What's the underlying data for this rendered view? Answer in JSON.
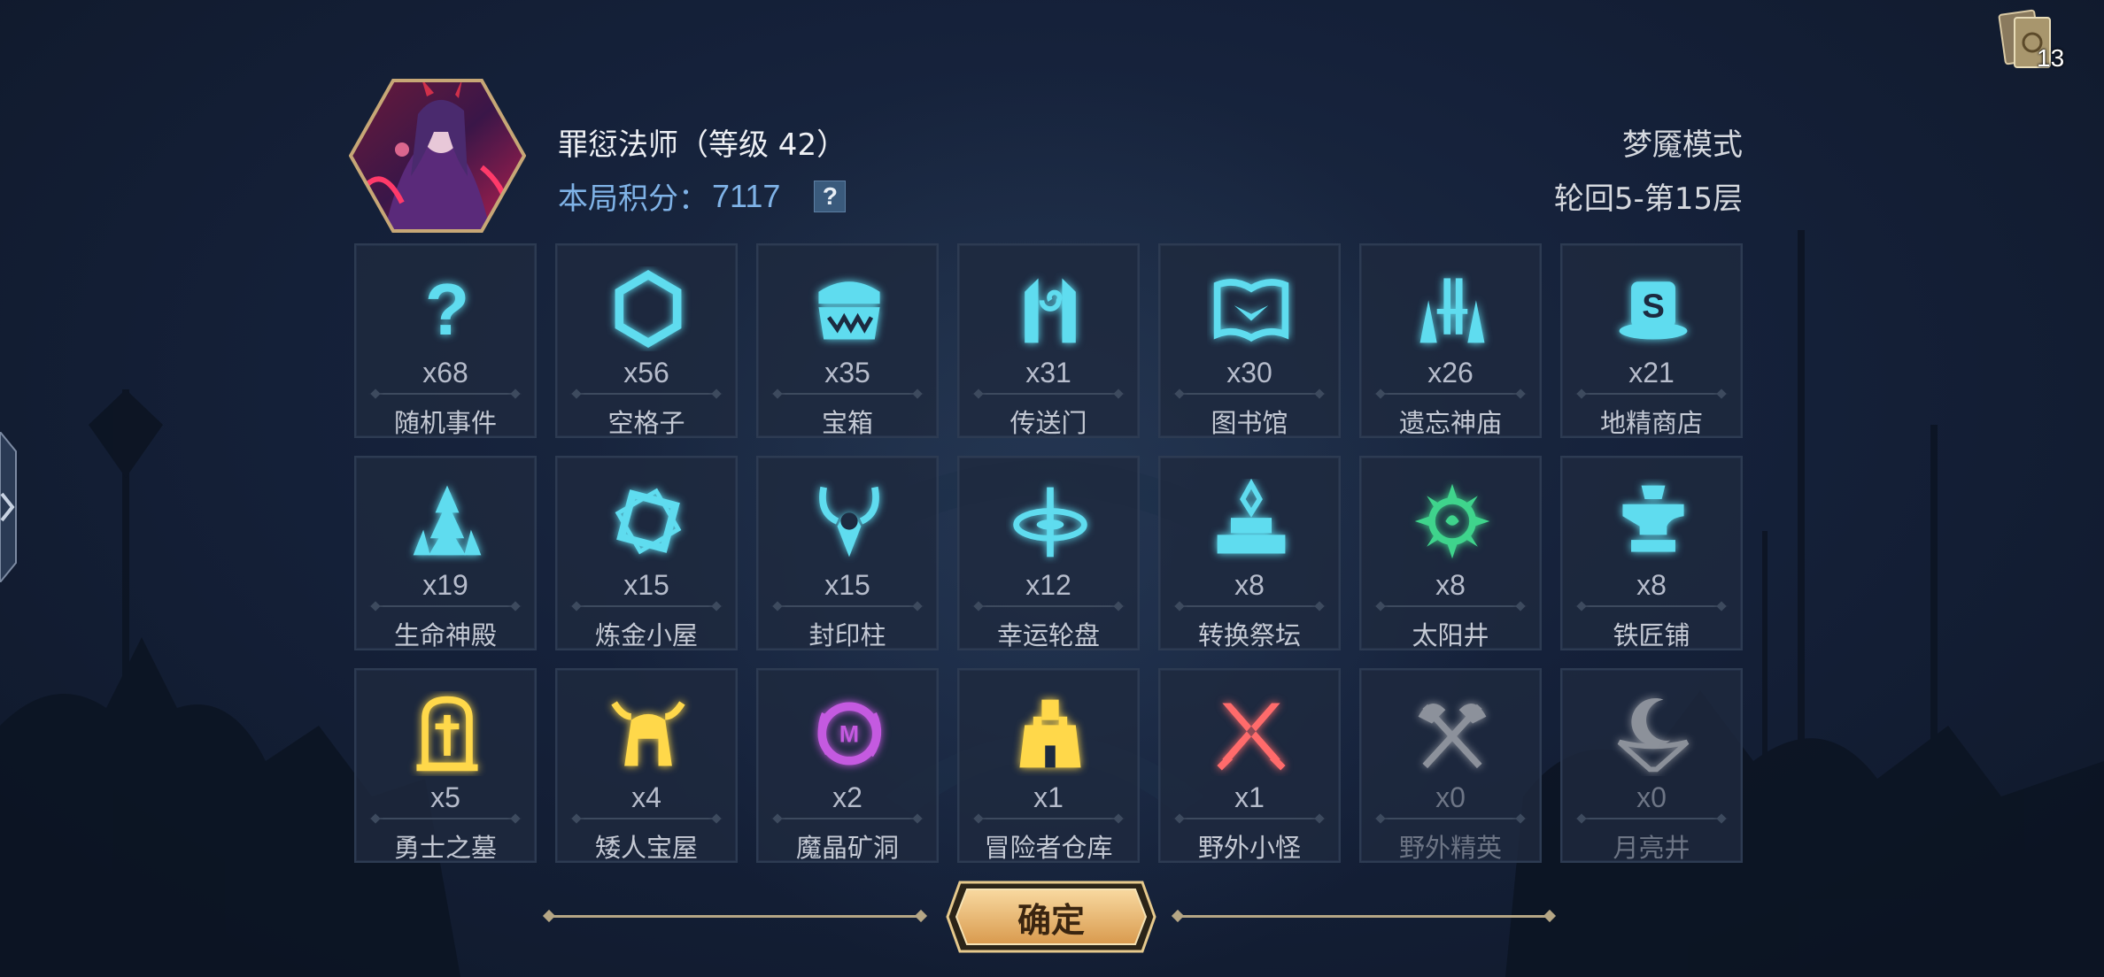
{
  "deck": {
    "count": "13",
    "icon": "card-deck-icon"
  },
  "hero": {
    "name": "罪愆法师（等级 42）",
    "avatar": "hero-portrait"
  },
  "score": {
    "label": "本局积分：",
    "value": "7117",
    "help": "?"
  },
  "mode": {
    "name": "梦魇模式",
    "floor": "轮回5-第15层"
  },
  "tiles": [
    {
      "count": "x68",
      "label": "随机事件",
      "icon": "question-icon",
      "color": "#5fdcef"
    },
    {
      "count": "x56",
      "label": "空格子",
      "icon": "hexagon-icon",
      "color": "#5fdcef"
    },
    {
      "count": "x35",
      "label": "宝箱",
      "icon": "chest-icon",
      "color": "#5fdcef"
    },
    {
      "count": "x31",
      "label": "传送门",
      "icon": "portal-icon",
      "color": "#5fdcef"
    },
    {
      "count": "x30",
      "label": "图书馆",
      "icon": "book-icon",
      "color": "#5fdcef"
    },
    {
      "count": "x26",
      "label": "遗忘神庙",
      "icon": "temple-icon",
      "color": "#5fdcef"
    },
    {
      "count": "x21",
      "label": "地精商店",
      "icon": "goblin-shop-icon",
      "color": "#5fdcef"
    },
    {
      "count": "x19",
      "label": "生命神殿",
      "icon": "life-shrine-icon",
      "color": "#5fdcef"
    },
    {
      "count": "x15",
      "label": "炼金小屋",
      "icon": "alchemy-icon",
      "color": "#5fdcef"
    },
    {
      "count": "x15",
      "label": "封印柱",
      "icon": "seal-pillar-icon",
      "color": "#5fdcef"
    },
    {
      "count": "x12",
      "label": "幸运轮盘",
      "icon": "wheel-icon",
      "color": "#5fdcef"
    },
    {
      "count": "x8",
      "label": "转换祭坛",
      "icon": "altar-icon",
      "color": "#5fdcef"
    },
    {
      "count": "x8",
      "label": "太阳井",
      "icon": "sun-well-icon",
      "color": "#3fd48c"
    },
    {
      "count": "x8",
      "label": "铁匠铺",
      "icon": "anvil-icon",
      "color": "#5fdcef"
    },
    {
      "count": "x5",
      "label": "勇士之墓",
      "icon": "tomb-icon",
      "color": "#ffd84a"
    },
    {
      "count": "x4",
      "label": "矮人宝屋",
      "icon": "dwarf-helm-icon",
      "color": "#ffd84a"
    },
    {
      "count": "x2",
      "label": "魔晶矿洞",
      "icon": "crystal-mine-icon",
      "color": "#c45ae0"
    },
    {
      "count": "x1",
      "label": "冒险者仓库",
      "icon": "castle-icon",
      "color": "#ffd84a"
    },
    {
      "count": "x1",
      "label": "野外小怪",
      "icon": "crossed-swords-icon",
      "color": "#ff6b6b"
    },
    {
      "count": "x0",
      "label": "野外精英",
      "icon": "crossed-axes-icon",
      "color": "#e8e8e8",
      "dim": true
    },
    {
      "count": "x0",
      "label": "月亮井",
      "icon": "moon-well-icon",
      "color": "#e8e8e8",
      "dim": true
    }
  ],
  "confirm": {
    "label": "确定"
  }
}
